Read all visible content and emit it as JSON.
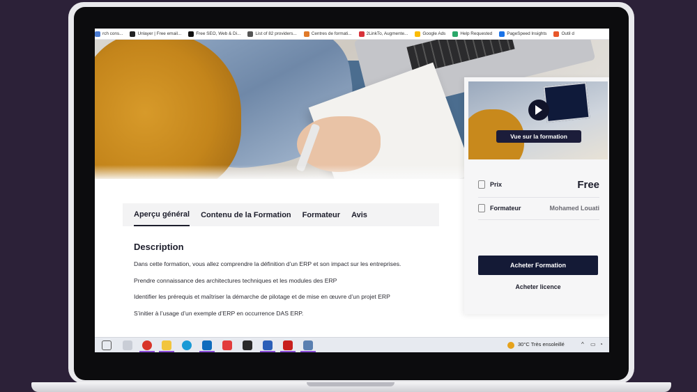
{
  "bookmarks": [
    {
      "label": "rch cons...",
      "color": "#4a7bd1"
    },
    {
      "label": "Unlayer | Free email...",
      "color": "#222222"
    },
    {
      "label": "Free SEO, Web & Di...",
      "color": "#111111"
    },
    {
      "label": "List of 82 providers...",
      "color": "#555555"
    },
    {
      "label": "Centres de formati...",
      "color": "#e07a2a"
    },
    {
      "label": "2LinkTo, Augmente...",
      "color": "#d8323a"
    },
    {
      "label": "Google Ads",
      "color": "#fbbc05"
    },
    {
      "label": "Help Requested",
      "color": "#2aa86a"
    },
    {
      "label": "PageSpeed Insights",
      "color": "#1a73e8"
    },
    {
      "label": "Outil d",
      "color": "#e8572a"
    }
  ],
  "tabs": [
    {
      "label": "Aperçu général",
      "active": true
    },
    {
      "label": "Contenu de la Formation",
      "active": false
    },
    {
      "label": "Formateur",
      "active": false
    },
    {
      "label": "Avis",
      "active": false
    }
  ],
  "description": {
    "title": "Description",
    "lines": [
      "Dans cette formation, vous allez comprendre la définition d’un ERP et son impact sur les entreprises.",
      "Prendre connaissance des architectures techniques et les modules des ERP",
      "Identifier les prérequis et maîtriser la démarche de pilotage et de mise en œuvre d’un projet ERP",
      "S’initier à l’usage d’un exemple d’ERP en occurrence DAS ERP."
    ]
  },
  "sidebar": {
    "video_label": "Vue sur la formation",
    "price_label": "Prix",
    "price_value": "Free",
    "trainer_label": "Formateur",
    "trainer_value": "Mohamed Louati",
    "buy_button": "Acheter Formation",
    "license_link": "Acheter licence"
  },
  "taskbar": {
    "weather": "30°C  Très ensoleillé",
    "icons": [
      "task-view-icon",
      "app-icon",
      "chrome-icon",
      "file-explorer-icon",
      "edge-icon",
      "outlook-icon",
      "video-app-icon",
      "davinci-icon",
      "word-icon",
      "acrobat-icon",
      "remote-icon"
    ]
  },
  "colors": {
    "navy": "#141a36",
    "text_dark": "#1c1d2b",
    "background": "#2c2138"
  }
}
